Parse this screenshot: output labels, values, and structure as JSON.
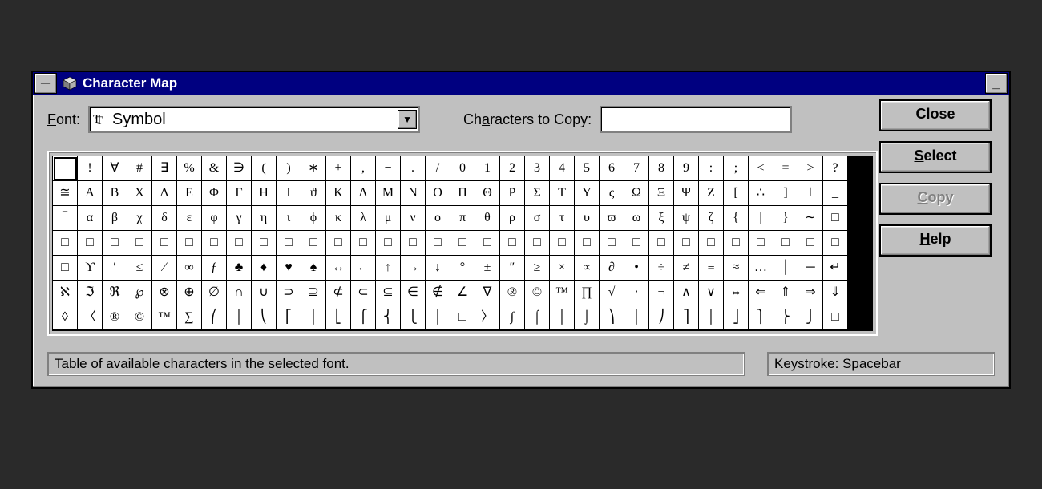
{
  "title": "Character Map",
  "labels": {
    "font": "Font:",
    "font_ul": "F",
    "font_rest": "ont:",
    "chars_to_copy_pre": "Ch",
    "chars_to_copy_ul": "a",
    "chars_to_copy_post": "racters to Copy:"
  },
  "font_value": "Symbol",
  "copy_value": "",
  "buttons": {
    "close": "Close",
    "select_ul": "S",
    "select_rest": "elect",
    "copy_ul": "C",
    "copy_rest": "opy",
    "help_ul": "H",
    "help_rest": "elp"
  },
  "status": {
    "help": "Table of available characters in the selected font.",
    "keystroke": "Keystroke: Spacebar"
  },
  "selected_index": 0,
  "chars": [
    " ",
    "!",
    "∀",
    "#",
    "∃",
    "%",
    "&",
    "∋",
    "(",
    ")",
    "∗",
    "+",
    ",",
    "−",
    ".",
    "/",
    "0",
    "1",
    "2",
    "3",
    "4",
    "5",
    "6",
    "7",
    "8",
    "9",
    ":",
    ";",
    "<",
    "=",
    ">",
    "?",
    "≅",
    "Α",
    "Β",
    "Χ",
    "Δ",
    "Ε",
    "Φ",
    "Γ",
    "Η",
    "Ι",
    "ϑ",
    "Κ",
    "Λ",
    "Μ",
    "Ν",
    "Ο",
    "Π",
    "Θ",
    "Ρ",
    "Σ",
    "Τ",
    "Υ",
    "ς",
    "Ω",
    "Ξ",
    "Ψ",
    "Ζ",
    "[",
    "∴",
    "]",
    "⊥",
    "_",
    "‾",
    "α",
    "β",
    "χ",
    "δ",
    "ε",
    "φ",
    "γ",
    "η",
    "ι",
    "ϕ",
    "κ",
    "λ",
    "μ",
    "ν",
    "ο",
    "π",
    "θ",
    "ρ",
    "σ",
    "τ",
    "υ",
    "ϖ",
    "ω",
    "ξ",
    "ψ",
    "ζ",
    "{",
    "|",
    "}",
    "∼",
    "□",
    "□",
    "□",
    "□",
    "□",
    "□",
    "□",
    "□",
    "□",
    "□",
    "□",
    "□",
    "□",
    "□",
    "□",
    "□",
    "□",
    "□",
    "□",
    "□",
    "□",
    "□",
    "□",
    "□",
    "□",
    "□",
    "□",
    "□",
    "□",
    "□",
    "□",
    "□",
    "□",
    "□",
    "ϒ",
    "′",
    "≤",
    "⁄",
    "∞",
    "ƒ",
    "♣",
    "♦",
    "♥",
    "♠",
    "↔",
    "←",
    "↑",
    "→",
    "↓",
    "°",
    "±",
    "″",
    "≥",
    "×",
    "∝",
    "∂",
    "•",
    "÷",
    "≠",
    "≡",
    "≈",
    "…",
    "│",
    "─",
    "↵",
    "ℵ",
    "ℑ",
    "ℜ",
    "℘",
    "⊗",
    "⊕",
    "∅",
    "∩",
    "∪",
    "⊃",
    "⊇",
    "⊄",
    "⊂",
    "⊆",
    "∈",
    "∉",
    "∠",
    "∇",
    "®",
    "©",
    "™",
    "∏",
    "√",
    "⋅",
    "¬",
    "∧",
    "∨",
    "⇔",
    "⇐",
    "⇑",
    "⇒",
    "⇓",
    "◊",
    "〈",
    "®",
    "©",
    "™",
    "∑",
    "⎛",
    "│",
    "⎝",
    "⎡",
    "│",
    "⎣",
    "⎧",
    "⎨",
    "⎩",
    "│",
    "□",
    "〉",
    "∫",
    "⌠",
    "│",
    "⌡",
    "⎞",
    "│",
    "⎠",
    "⎤",
    "│",
    "⎦",
    "⎫",
    "⎬",
    "⎭",
    "□"
  ]
}
